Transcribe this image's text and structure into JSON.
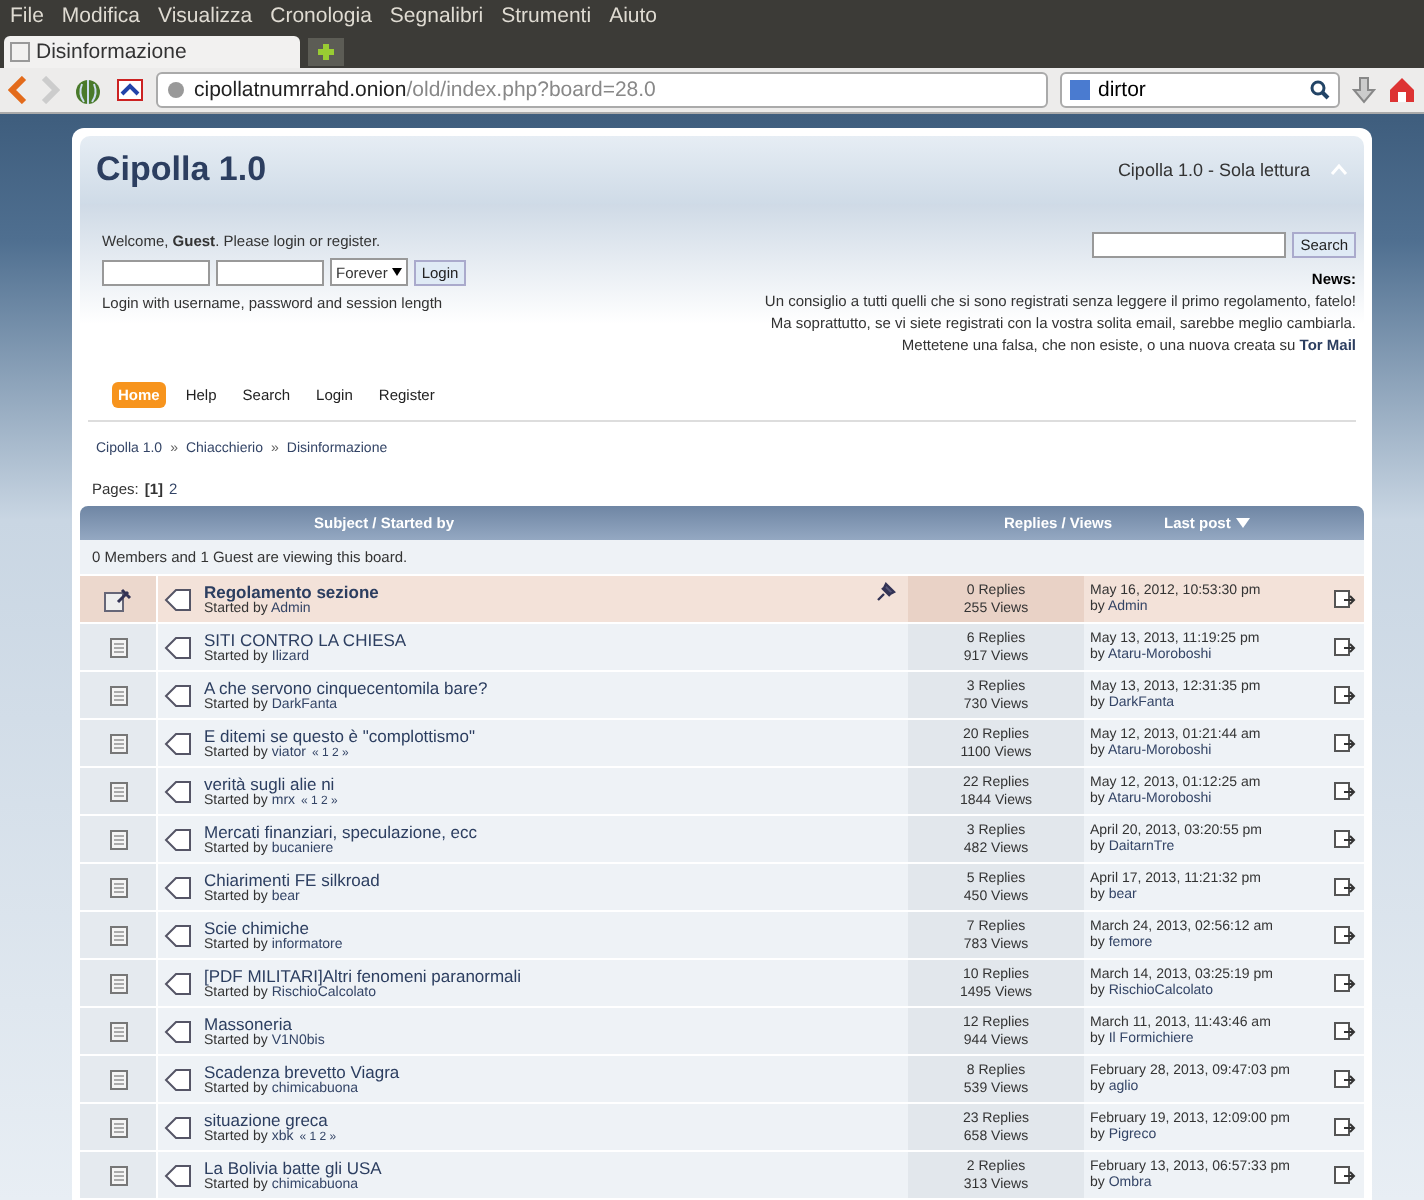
{
  "menubar": [
    "File",
    "Modifica",
    "Visualizza",
    "Cronologia",
    "Segnalibri",
    "Strumenti",
    "Aiuto"
  ],
  "tab": {
    "title": "Disinformazione",
    "selected": true
  },
  "address_bar": {
    "host": "cipollatnumrrahd.onion",
    "path": "/old/index.php?board=28.0"
  },
  "search_bar": {
    "value": "dirtor"
  },
  "forum": {
    "title": "Cipolla 1.0",
    "subtitle": "Cipolla 1.0 - Sola lettura"
  },
  "user": {
    "welcome": "Welcome, **Guest**. Please login or register.",
    "session_option": "Forever",
    "login_button": "Login",
    "hint": "Login with username, password and session length"
  },
  "search": {
    "button": "Search"
  },
  "news": {
    "title": "News:",
    "lines": [
      "Un consiglio a tutti quelli che si sono registrati senza leggere il primo regolamento, fatelo!",
      "Ma soprattutto, se vi siete registrati con la vostra solita email, sarebbe meglio cambiarla.",
      "Mettetene una falsa, che non esiste, o una nuova creata su **Tor Mail**"
    ]
  },
  "nav": [
    {
      "label": "Home",
      "selected": true
    },
    {
      "label": "Help",
      "selected": false
    },
    {
      "label": "Search",
      "selected": false
    },
    {
      "label": "Login",
      "selected": false
    },
    {
      "label": "Register",
      "selected": false
    }
  ],
  "breadcrumbs": [
    {
      "label": "Cipolla 1.0"
    },
    {
      "separator": "»",
      "label": "Chiacchierio"
    },
    {
      "separator": "»",
      "label": "Disinformazione"
    }
  ],
  "pages": {
    "label": "Pages:",
    "items": [
      {
        "label": "[1]",
        "selected": true
      },
      {
        "label": "2",
        "selected": false
      }
    ]
  },
  "table": {
    "columns": [
      "Subject / Started by",
      "Replies / Views",
      "Last post"
    ],
    "viewing": "0 Members and 1 Guest are viewing this board.",
    "rows": [
      {
        "subject": "Regolamento sezione",
        "started_label": "Started by",
        "author": "Admin",
        "sticky": true,
        "pages": [],
        "replies": "0 Replies",
        "views": "255 Views",
        "last_date": "May 16, 2012, 10:53:30 pm",
        "by_label": "by",
        "last_by": "Admin"
      },
      {
        "subject": "SITI CONTRO LA CHIESA",
        "started_label": "Started by",
        "author": "Ilizard",
        "sticky": false,
        "pages": [],
        "replies": "6 Replies",
        "views": "917 Views",
        "last_date": "May 13, 2013, 11:19:25 pm",
        "by_label": "by",
        "last_by": "Ataru-Moroboshi"
      },
      {
        "subject": "A che servono cinquecentomila bare?",
        "started_label": "Started by",
        "author": "DarkFanta",
        "sticky": false,
        "pages": [],
        "replies": "3 Replies",
        "views": "730 Views",
        "last_date": "May 13, 2013, 12:31:35 pm",
        "by_label": "by",
        "last_by": "DarkFanta"
      },
      {
        "subject": "E ditemi se questo è \"complottismo\"",
        "started_label": "Started by",
        "author": "viator",
        "sticky": false,
        "pages": [
          "«",
          "1",
          "2",
          "»"
        ],
        "replies": "20 Replies",
        "views": "1100 Views",
        "last_date": "May 12, 2013, 01:21:44 am",
        "by_label": "by",
        "last_by": "Ataru-Moroboshi"
      },
      {
        "subject": "verità sugli alie ni",
        "started_label": "Started by",
        "author": "mrx",
        "sticky": false,
        "pages": [
          "«",
          "1",
          "2",
          "»"
        ],
        "replies": "22 Replies",
        "views": "1844 Views",
        "last_date": "May 12, 2013, 01:12:25 am",
        "by_label": "by",
        "last_by": "Ataru-Moroboshi"
      },
      {
        "subject": "Mercati finanziari, speculazione, ecc",
        "started_label": "Started by",
        "author": "bucaniere",
        "sticky": false,
        "pages": [],
        "replies": "3 Replies",
        "views": "482 Views",
        "last_date": "April 20, 2013, 03:20:55 pm",
        "by_label": "by",
        "last_by": "DaitarnTre"
      },
      {
        "subject": "Chiarimenti FE silkroad",
        "started_label": "Started by",
        "author": "bear",
        "sticky": false,
        "pages": [],
        "replies": "5 Replies",
        "views": "450 Views",
        "last_date": "April 17, 2013, 11:21:32 pm",
        "by_label": "by",
        "last_by": "bear"
      },
      {
        "subject": "Scie chimiche",
        "started_label": "Started by",
        "author": "informatore",
        "sticky": false,
        "pages": [],
        "replies": "7 Replies",
        "views": "783 Views",
        "last_date": "March 24, 2013, 02:56:12 am",
        "by_label": "by",
        "last_by": "femore"
      },
      {
        "subject": "[PDF MILITARI]Altri fenomeni paranormali",
        "started_label": "Started by",
        "author": "RischioCalcolato",
        "sticky": false,
        "pages": [],
        "replies": "10 Replies",
        "views": "1495 Views",
        "last_date": "March 14, 2013, 03:25:19 pm",
        "by_label": "by",
        "last_by": "RischioCalcolato"
      },
      {
        "subject": "Massoneria",
        "started_label": "Started by",
        "author": "V1N0bis",
        "sticky": false,
        "pages": [],
        "replies": "12 Replies",
        "views": "944 Views",
        "last_date": "March 11, 2013, 11:43:46 am",
        "by_label": "by",
        "last_by": "Il Formichiere"
      },
      {
        "subject": "Scadenza brevetto Viagra",
        "started_label": "Started by",
        "author": "chimicabuona",
        "sticky": false,
        "pages": [],
        "replies": "8 Replies",
        "views": "539 Views",
        "last_date": "February 28, 2013, 09:47:03 pm",
        "by_label": "by",
        "last_by": "aglio"
      },
      {
        "subject": "situazione greca",
        "started_label": "Started by",
        "author": "xbk",
        "sticky": false,
        "pages": [
          "«",
          "1",
          "2",
          "»"
        ],
        "replies": "23 Replies",
        "views": "658 Views",
        "last_date": "February 19, 2013, 12:09:00 pm",
        "by_label": "by",
        "last_by": "Pigreco"
      },
      {
        "subject": "La Bolivia batte gli USA",
        "started_label": "Started by",
        "author": "chimicabuona",
        "sticky": false,
        "pages": [],
        "replies": "2 Replies",
        "views": "313 Views",
        "last_date": "February 13, 2013, 06:57:33 pm",
        "by_label": "by",
        "last_by": "Ombra"
      }
    ]
  }
}
